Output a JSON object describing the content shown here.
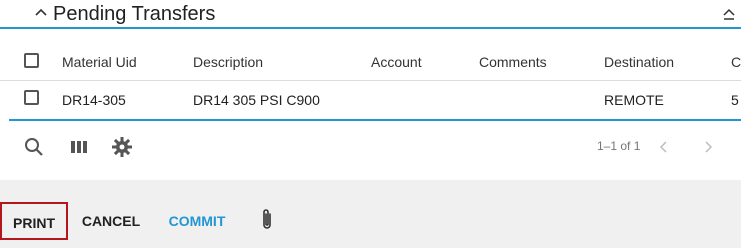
{
  "panel": {
    "title": "Pending Transfers"
  },
  "table": {
    "columns": [
      "Material Uid",
      "Description",
      "Account",
      "Comments",
      "Destination",
      "C"
    ],
    "rows": [
      {
        "material_uid": "DR14-305",
        "description": "DR14 305 PSI C900",
        "account": "",
        "comments": "",
        "destination": "REMOTE",
        "extra": "5"
      }
    ]
  },
  "toolbar": {
    "icons": [
      "search-icon",
      "columns-icon",
      "gear-icon"
    ]
  },
  "pager": {
    "text": "1–1 of 1"
  },
  "footer": {
    "print_label": "PRINT",
    "cancel_label": "CANCEL",
    "commit_label": "COMMIT"
  },
  "colors": {
    "accent": "#2196d3",
    "print_border": "#b3171d",
    "footer_bg": "#f0f0f0"
  }
}
